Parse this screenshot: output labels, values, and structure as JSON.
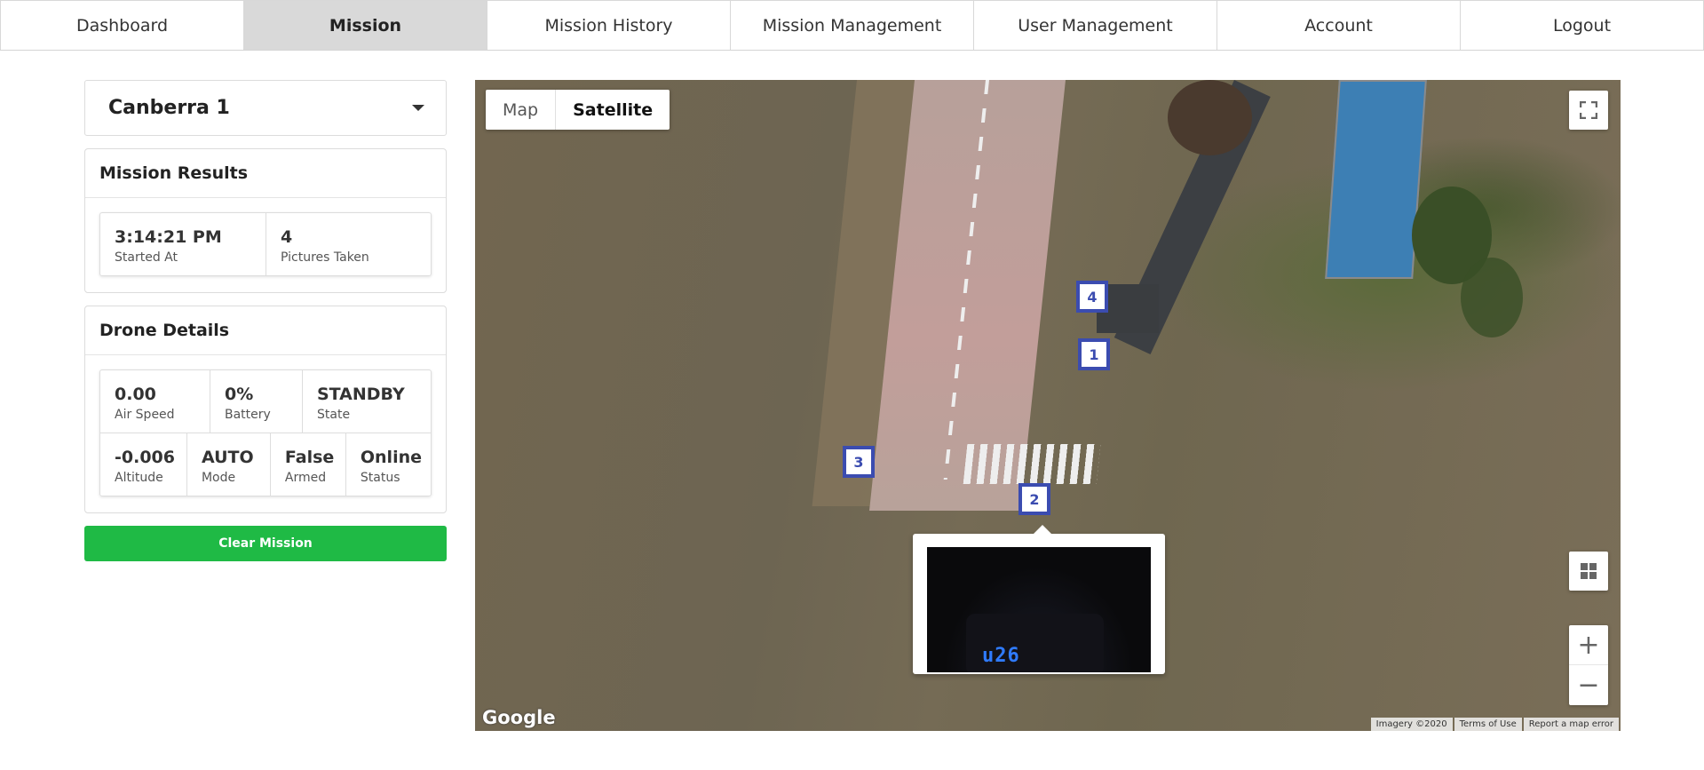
{
  "nav": {
    "tabs": [
      "Dashboard",
      "Mission",
      "Mission History",
      "Mission Management",
      "User Management",
      "Account",
      "Logout"
    ],
    "active": "Mission"
  },
  "mission_select": {
    "value": "Canberra 1",
    "icon": "chevron-down-icon"
  },
  "mission_results": {
    "title": "Mission Results",
    "started_at": {
      "value": "3:14:21 PM",
      "label": "Started At"
    },
    "pictures": {
      "value": "4",
      "label": "Pictures Taken"
    }
  },
  "drone_details": {
    "title": "Drone Details",
    "air_speed": {
      "value": "0.00",
      "label": "Air Speed"
    },
    "battery": {
      "value": "0%",
      "label": "Battery"
    },
    "state": {
      "value": "STANDBY",
      "label": "State"
    },
    "altitude": {
      "value": "-0.006",
      "label": "Altitude"
    },
    "mode": {
      "value": "AUTO",
      "label": "Mode"
    },
    "armed": {
      "value": "False",
      "label": "Armed"
    },
    "status": {
      "value": "Online",
      "label": "Status"
    }
  },
  "clear_button": "Clear Mission",
  "map": {
    "type_buttons": {
      "map": "Map",
      "satellite": "Satellite",
      "active": "Satellite"
    },
    "markers": [
      "1",
      "2",
      "3",
      "4"
    ],
    "popup_photo_text": "u26",
    "google_logo": "Google",
    "attribution": {
      "imagery": "Imagery ©2020",
      "terms": "Terms of Use",
      "report": "Report a map error"
    },
    "controls": {
      "fullscreen": "fullscreen-icon",
      "layers": "grid-icon",
      "zoom_in": "+",
      "zoom_out": "−"
    }
  },
  "colors": {
    "accent_green": "#1fba45",
    "marker_blue": "#3b4cb0",
    "active_tab": "#d9d9d9"
  }
}
